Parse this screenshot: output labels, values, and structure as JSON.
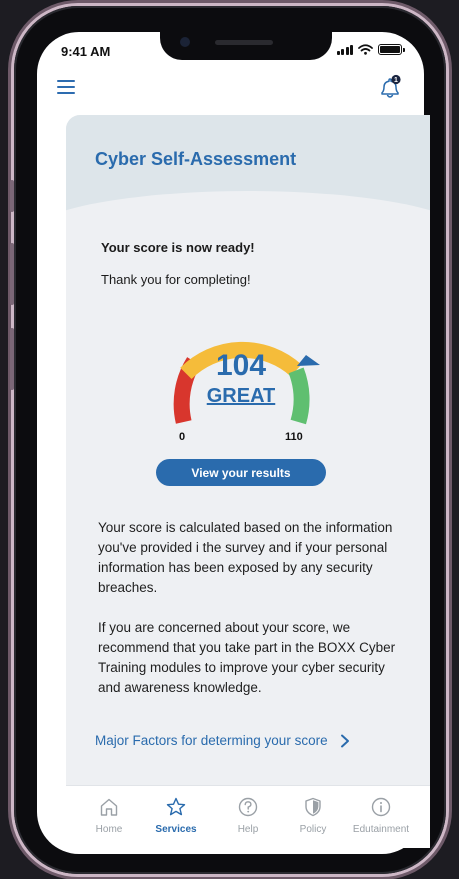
{
  "status_bar": {
    "time": "9:41 AM"
  },
  "header": {
    "menu_icon": "hamburger-icon",
    "notification_icon": "bell-icon",
    "notification_count": "1"
  },
  "page": {
    "title": "Cyber Self-Assessment"
  },
  "score_card": {
    "ready_text": "Your score is now ready!",
    "thanks_text": "Thank you for completing!",
    "score": "104",
    "rating": "GREAT",
    "min": "0",
    "max": "110",
    "gauge_colors": [
      "#d8362d",
      "#f5bc3a",
      "#5fbf70"
    ],
    "pointer_color": "#2a6bad",
    "button_label": "View your results"
  },
  "info": {
    "paragraph1": "Your score is calculated based on the information you've provided i the survey and if your personal information has been exposed by any security breaches.",
    "paragraph2": "If you are concerned about your score, we recommend that you take part in the BOXX Cyber Training modules to improve your cyber security and awareness knowledge.",
    "link": "Major Factors for determing your score"
  },
  "tabs": [
    {
      "label": "Home",
      "icon": "home-icon",
      "active": false
    },
    {
      "label": "Services",
      "icon": "star-icon",
      "active": true
    },
    {
      "label": "Help",
      "icon": "help-icon",
      "active": false
    },
    {
      "label": "Policy",
      "icon": "shield-icon",
      "active": false
    },
    {
      "label": "Edutainment",
      "icon": "info-icon",
      "active": false
    }
  ],
  "colors": {
    "accent": "#2a6bad",
    "background": "#eef0f3",
    "hero": "#dde5ea"
  }
}
